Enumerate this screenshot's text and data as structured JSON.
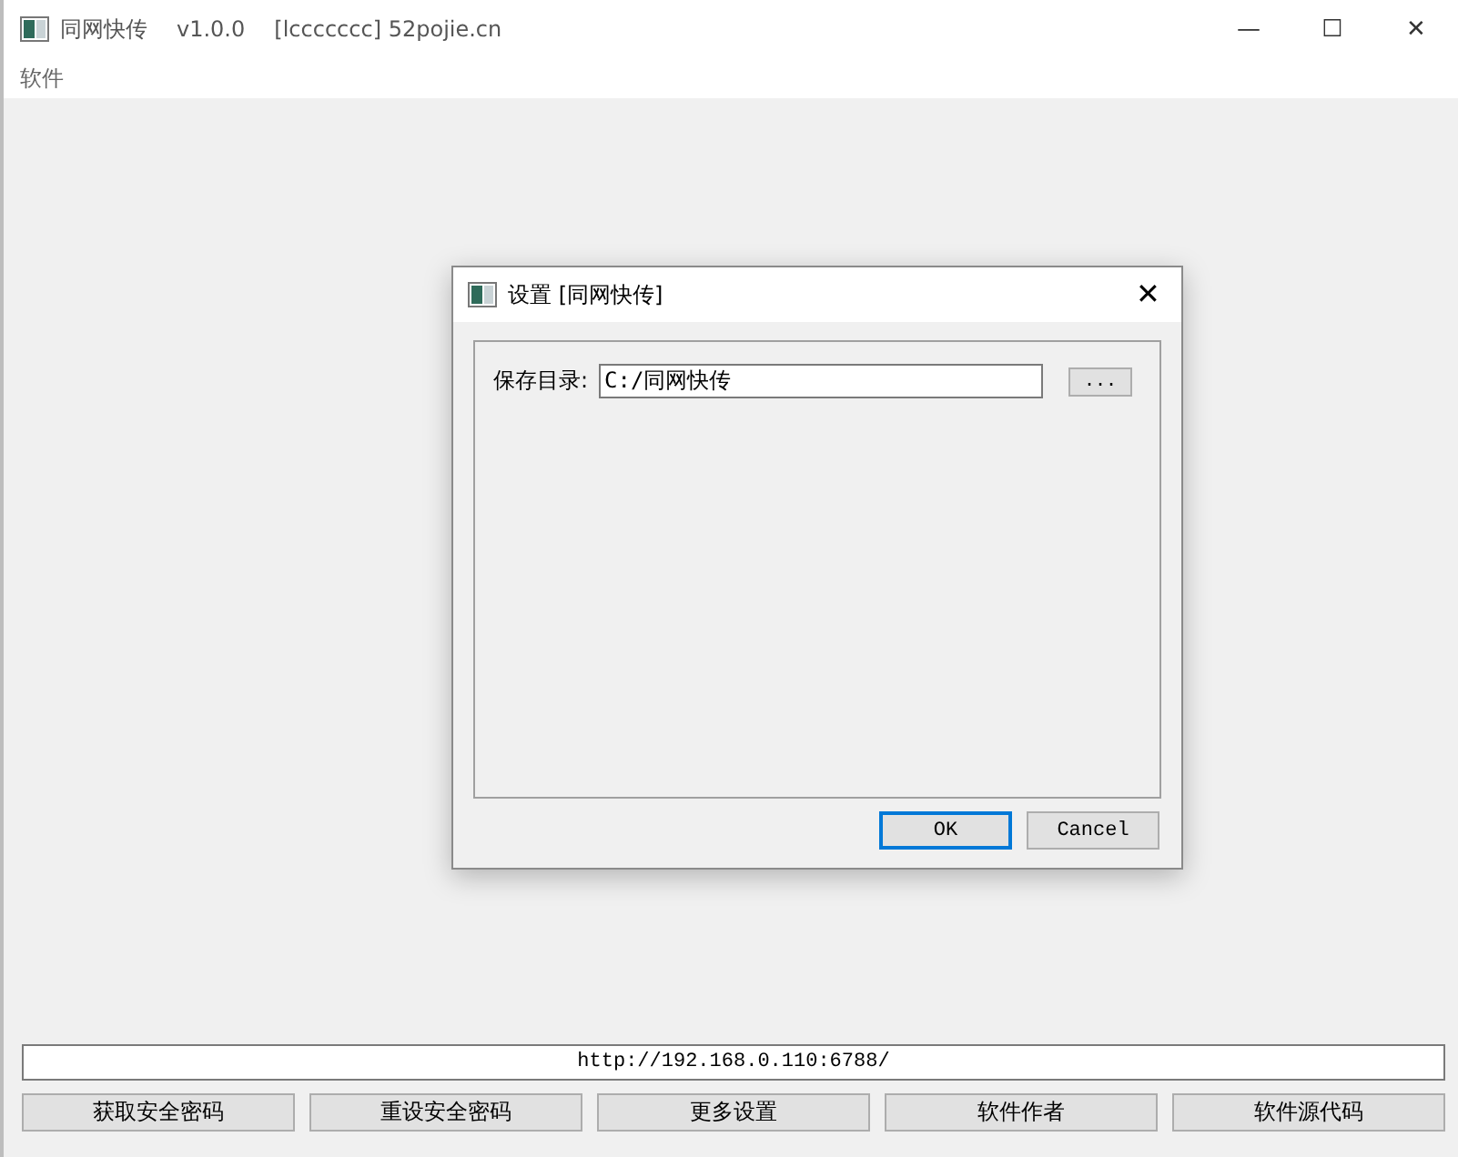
{
  "window": {
    "title": "同网快传",
    "version": "v1.0.0",
    "subtitle": "[lccccccc] 52pojie.cn",
    "controls": [
      "—",
      "☐",
      "✕"
    ]
  },
  "menu": [
    {
      "label": "软件"
    }
  ],
  "dialog": {
    "title": "设置 [同网快传]",
    "close": "✕",
    "field_label": "保存目录:",
    "field_value": "C:/同网快传",
    "browse": "...",
    "buttons": [
      {
        "label": "OK",
        "default": true
      },
      {
        "label": "Cancel",
        "default": false
      }
    ]
  },
  "url": {
    "value": "http://192.168.0.110:6788/"
  },
  "buttons": [
    {
      "label": "获取安全密码"
    },
    {
      "label": "重设安全密码"
    },
    {
      "label": "更多设置"
    },
    {
      "label": "软件作者"
    },
    {
      "label": "软件源代码"
    }
  ]
}
